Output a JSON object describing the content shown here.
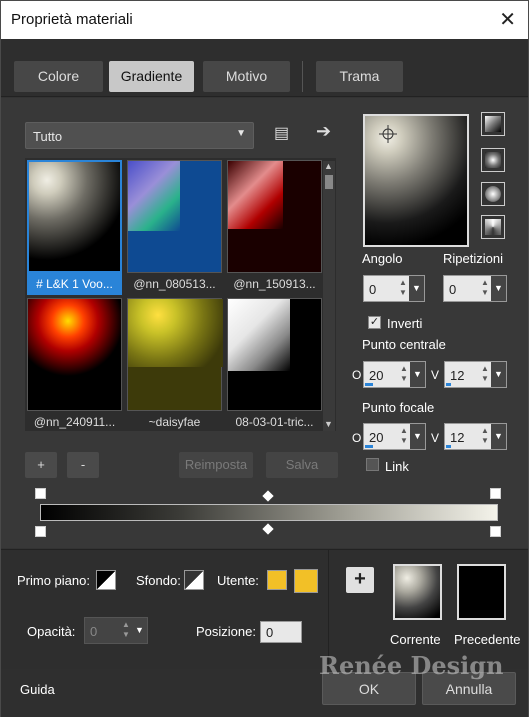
{
  "window": {
    "title": "Proprietà materiali"
  },
  "tabs": [
    "Colore",
    "Gradiente",
    "Motivo",
    "Trama"
  ],
  "gradient": {
    "category": "Tutto",
    "items": [
      "# L&K 1 Voo...",
      "@nn_080513...",
      "@nn_150913...",
      "@nn_240911...",
      "~daisyfae",
      "08-03-01-tric..."
    ]
  },
  "buttons": {
    "add": "+",
    "remove": "-",
    "reset": "Reimposta",
    "save": "Salva"
  },
  "editor": {
    "angle_label": "Angolo",
    "repeats_label": "Ripetizioni",
    "angle": "0",
    "repeats": "0",
    "invert_label": "Inverti",
    "invert_checked": true,
    "center_label": "Punto centrale",
    "focal_label": "Punto focale",
    "h_letter": "O",
    "v_letter": "V",
    "center_h": "20",
    "center_v": "12",
    "focal_h": "20",
    "focal_v": "12",
    "link_label": "Link",
    "link_checked": false
  },
  "bottom": {
    "foreground_label": "Primo piano:",
    "background_label": "Sfondo:",
    "user_label": "Utente:",
    "user_color": "#f2c027",
    "opacity_label": "Opacità:",
    "opacity": "0",
    "position_label": "Posizione:",
    "position": "0",
    "add_symbol": "+",
    "current_label": "Corrente",
    "previous_label": "Precedente"
  },
  "footer": {
    "help": "Guida",
    "ok": "OK",
    "cancel": "Annulla"
  },
  "watermark": "Renée Design",
  "colors": {
    "accent": "#2a84d8",
    "panel": "#383838",
    "user_swatch": "#f2c027"
  }
}
